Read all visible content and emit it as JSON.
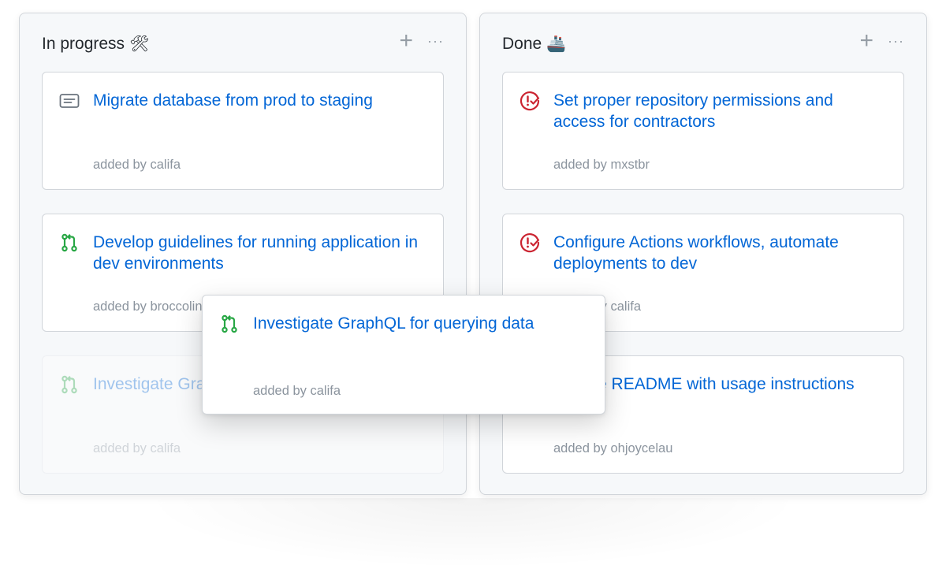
{
  "board": {
    "columns": [
      {
        "title": "In progress",
        "emoji": "🛠",
        "add_label": "+",
        "more_label": "···",
        "cards": [
          {
            "icon": "note-icon",
            "title": "Migrate database from prod to staging",
            "meta": "added by califa"
          },
          {
            "icon": "pull-request-icon",
            "title": "Develop guidelines for running application in dev environments",
            "meta": "added by broccolini"
          },
          {
            "icon": "pull-request-icon",
            "title": "Investigate GraphQL for querying data",
            "meta": "added by califa"
          }
        ]
      },
      {
        "title": "Done",
        "emoji": "🚢",
        "add_label": "+",
        "more_label": "···",
        "cards": [
          {
            "icon": "issue-closed-icon",
            "title": "Set proper repository permissions and access for contractors",
            "meta": "added by mxstbr"
          },
          {
            "icon": "issue-closed-icon",
            "title": "Configure Actions workflows, automate deployments to dev",
            "meta": "added by califa"
          },
          {
            "icon": "issue-closed-icon",
            "title": "Update README with usage instructions",
            "meta": "added by ohjoycelau"
          }
        ]
      }
    ],
    "dragging_card": {
      "icon": "pull-request-icon",
      "title": "Investigate GraphQL for querying data",
      "meta": "added by califa"
    }
  },
  "colors": {
    "link": "#0366d6",
    "pr_green": "#28a745",
    "issue_red": "#cb2431",
    "muted": "#8b949e"
  }
}
